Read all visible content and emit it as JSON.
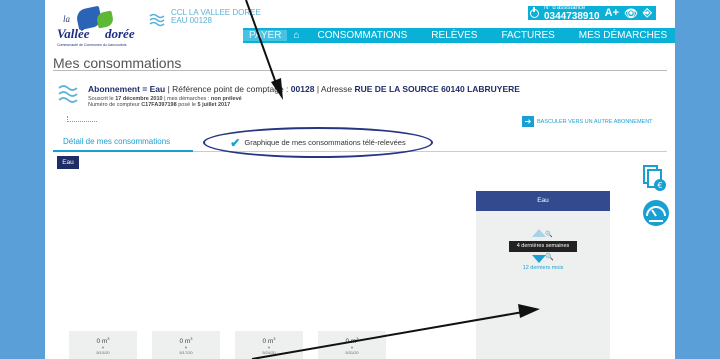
{
  "logo": {
    "la": "la",
    "vallee": "Vallée",
    "doree": "dorée",
    "subtitle": "Communauté de Communes du Liancourtois"
  },
  "contract": {
    "name": "CCL LA VALLEE DOREE",
    "number": "EAU 00128"
  },
  "assistance": {
    "label": "N° d'assistance",
    "phone": "0344738910"
  },
  "tools": {
    "font_size": "A+",
    "eye": "👁",
    "exit": "⎆"
  },
  "nav": {
    "payer": "PAYER",
    "home_icon": "home-icon",
    "consommations": "CONSOMMATIONS",
    "releves": "RELÈVES",
    "factures": "FACTURES",
    "demarches": "MES DÉMARCHES"
  },
  "page": {
    "title": "Mes consommations"
  },
  "abonnement": {
    "label_abo": "Abonnement = Eau",
    "label_ref": "Référence point de comptage :",
    "ref": "00128",
    "label_addr": "Adresse",
    "addr": "RUE DE LA SOURCE 60140 LABRUYERE",
    "souscrit_prefix": "Souscrit le",
    "souscrit_date": "17 décembre 2010",
    "demarches_prefix": "mes démarches :",
    "demarches_val": "non prélevé",
    "compteur_prefix": "Numéro de compteur",
    "compteur": "C17FA397198",
    "pose_prefix": "posé le",
    "pose_date": "5 juillet 2017"
  },
  "basculer": "BASCULER VERS UN AUTRE ABONNEMENT",
  "tabs": {
    "detail": "Détail de mes consommations",
    "graphique": "Graphique de mes consommations télé-relevées"
  },
  "badge": "Eau",
  "panel": {
    "header": "Eau",
    "pill": "4 dernières semaines",
    "link": "12 derniers mois"
  },
  "bars": [
    {
      "value": "0 m",
      "unit": "3",
      "date": "5/10/20"
    },
    {
      "value": "0 m",
      "unit": "3",
      "date": "5/17/20"
    },
    {
      "value": "0 m",
      "unit": "3",
      "date": "5/24/20"
    },
    {
      "value": "0 m",
      "unit": "3",
      "date": "5/31/20"
    }
  ],
  "colors": {
    "background": "#5a9fd8",
    "nav": "#0bb0d7",
    "accent": "#1a9fd3",
    "navy": "#1f2d66"
  }
}
